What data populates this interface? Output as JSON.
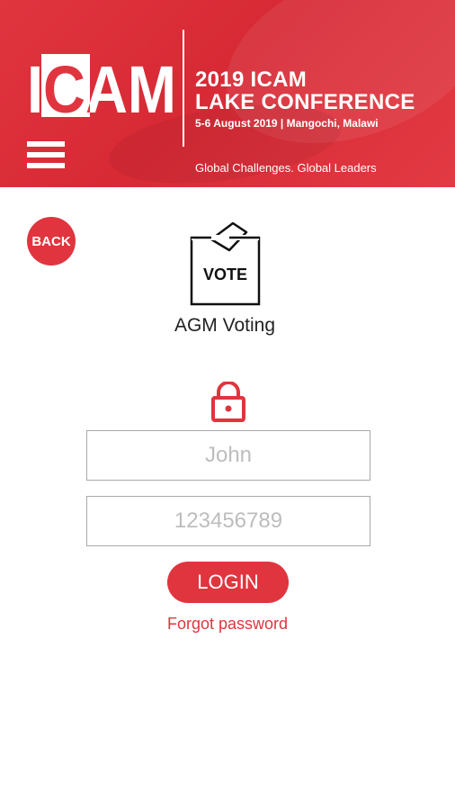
{
  "header": {
    "logo_text": "ICAM",
    "title_line1": "2019 ICAM",
    "title_line2": "LAKE CONFERENCE",
    "date_location": "5-6 August 2019 | Mangochi, Malawi",
    "tagline": "Global Challenges. Global Leaders",
    "menu_icon": "hamburger-menu-icon"
  },
  "back_button": {
    "label": "BACK"
  },
  "vote_icon": {
    "label": "VOTE"
  },
  "section": {
    "title": "AGM Voting"
  },
  "lock_icon": "lock-icon",
  "form": {
    "username_placeholder": "John",
    "password_placeholder": "123456789",
    "login_label": "LOGIN",
    "forgot_label": "Forgot password"
  },
  "colors": {
    "brand_red": "#e0353f",
    "field_border": "#a9a9a9"
  }
}
